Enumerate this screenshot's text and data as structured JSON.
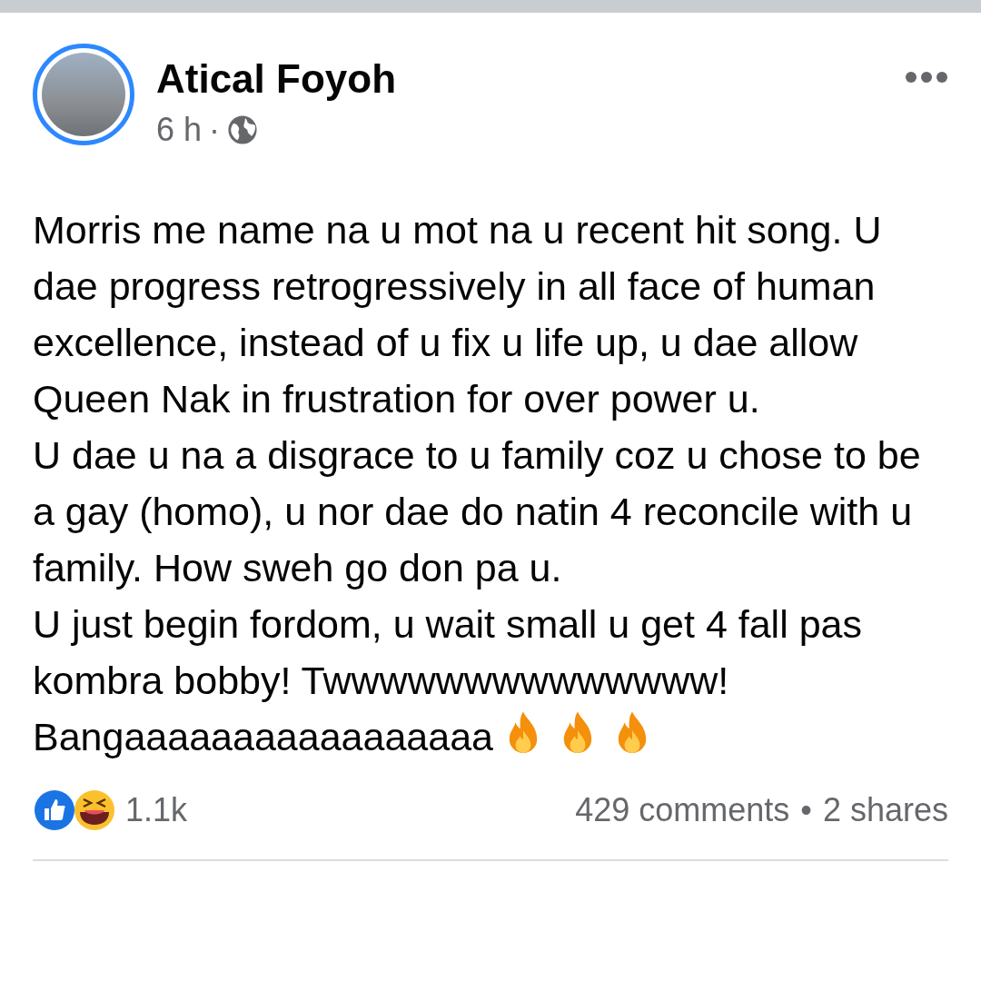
{
  "post": {
    "author": "Atical Foyoh",
    "time": "6 h",
    "separator": "·",
    "paragraphs": [
      "Morris me name na u mot na u recent hit song. U dae progress retrogressively in all face of human excellence, instead of u fix u life up, u dae allow Queen Nak in frustration for over power u.",
      "U dae u na a disgrace to u family coz u chose to be a gay (homo), u nor dae do natin 4 reconcile with u family. How sweh go don pa u.",
      "U just begin fordom, u wait small u get 4 fall pas kombra bobby! Twwwwwwwwwwwwww!",
      "Bangaaaaaaaaaaaaaaaaa"
    ],
    "reactions_count": "1.1k",
    "comments": "429 comments",
    "bullet": "•",
    "shares": "2 shares"
  }
}
